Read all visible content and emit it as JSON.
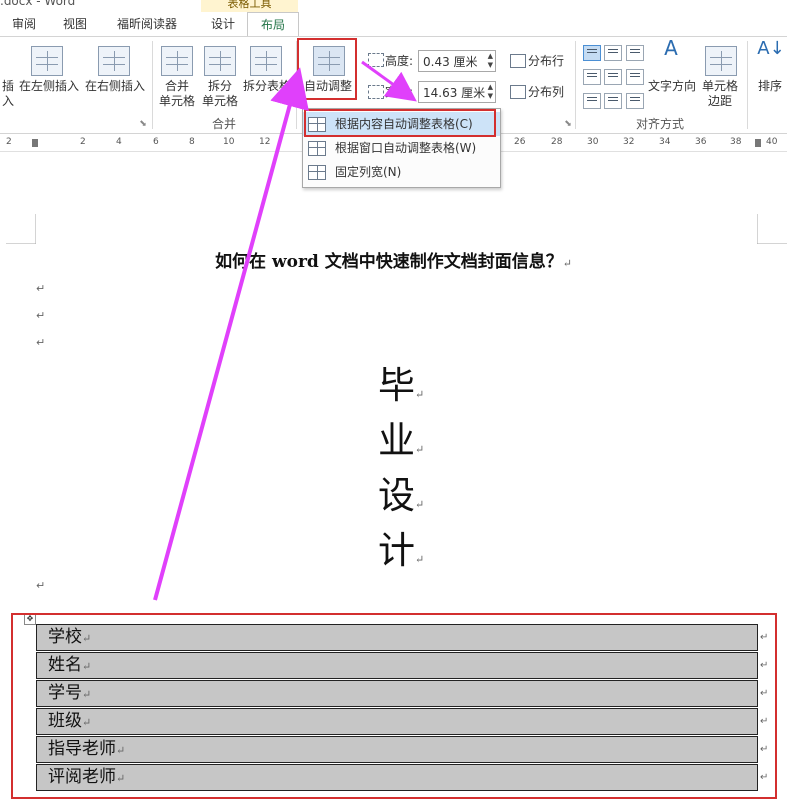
{
  "window": {
    "title": ".docx - Word"
  },
  "contextual_tab_header": "表格工具",
  "tabs": [
    "审阅",
    "视图",
    "福昕阅读器",
    "设计",
    "布局"
  ],
  "active_tab": "布局",
  "ribbon": {
    "rows_cols": {
      "insert_below_partial": "插入",
      "insert_left": "在左侧插入",
      "insert_right": "在右侧插入"
    },
    "merge_group": {
      "merge_cells": [
        "合并",
        "单元格"
      ],
      "split_cells": [
        "拆分",
        "单元格"
      ],
      "split_table": "拆分表格",
      "label": "合并"
    },
    "cell_size_group": {
      "autofit": "自动调整",
      "height_label": "高度:",
      "height_value": "0.43 厘米",
      "width_label": "宽度:",
      "width_value": "14.63 厘米",
      "distribute_rows": "分布行",
      "distribute_cols": "分布列"
    },
    "alignment_group": {
      "text_direction": "文字方向",
      "cell_margins": [
        "单元格",
        "边距"
      ],
      "label": "对齐方式"
    },
    "sort": "排序"
  },
  "ruler": {
    "numbers": [
      "2",
      "2",
      "4",
      "6",
      "8",
      "10",
      "12",
      "26",
      "28",
      "30",
      "32",
      "34",
      "36",
      "38",
      "40"
    ]
  },
  "autofit_menu": {
    "items": [
      "根据内容自动调整表格(C)",
      "根据窗口自动调整表格(W)",
      "固定列宽(N)"
    ],
    "highlighted_index": 0
  },
  "document": {
    "title": "如何在 word 文档中快速制作文档封面信息？",
    "paragraph_mark": "↵",
    "big_chars": [
      "毕",
      "业",
      "设",
      "计"
    ],
    "table_rows": [
      "学校",
      "姓名",
      "学号",
      "班级",
      "指导老师",
      "评阅老师"
    ]
  },
  "colors": {
    "annotation_red": "#d32f2f",
    "arrow_magenta": "#e040fb",
    "selection_gray": "#c6c6c6"
  }
}
